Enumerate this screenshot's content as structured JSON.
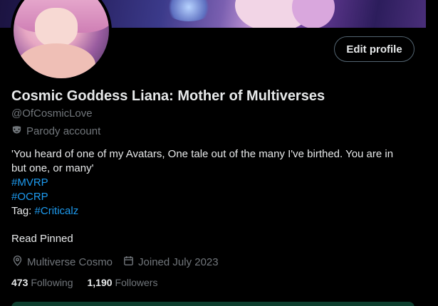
{
  "profile": {
    "display_name": "Cosmic Goddess Liana: Mother of Multiverses",
    "handle": "@OfCosmicLove",
    "parody_label": "Parody account",
    "edit_button": "Edit profile",
    "bio": {
      "quote_line1": "'You heard of one of my Avatars, One tale out of the many I've birthed. You are in",
      "quote_line2": "but one, or many'",
      "hashtag1": "#MVRP",
      "hashtag2": "#OCRP",
      "tag_prefix": "Tag: ",
      "tag_link": "#Criticalz"
    },
    "read_pinned": "Read Pinned",
    "location": "Multiverse Cosmo",
    "joined": "Joined July 2023",
    "following_count": "473",
    "following_label": "Following",
    "followers_count": "1,190",
    "followers_label": "Followers"
  },
  "icons": {
    "parody": "mask-icon",
    "location": "location-pin-icon",
    "calendar": "calendar-icon"
  },
  "colors": {
    "background": "#000000",
    "text_primary": "#e7e9ea",
    "text_secondary": "#71767b",
    "link": "#1d9bf0",
    "button_border": "#536471"
  }
}
